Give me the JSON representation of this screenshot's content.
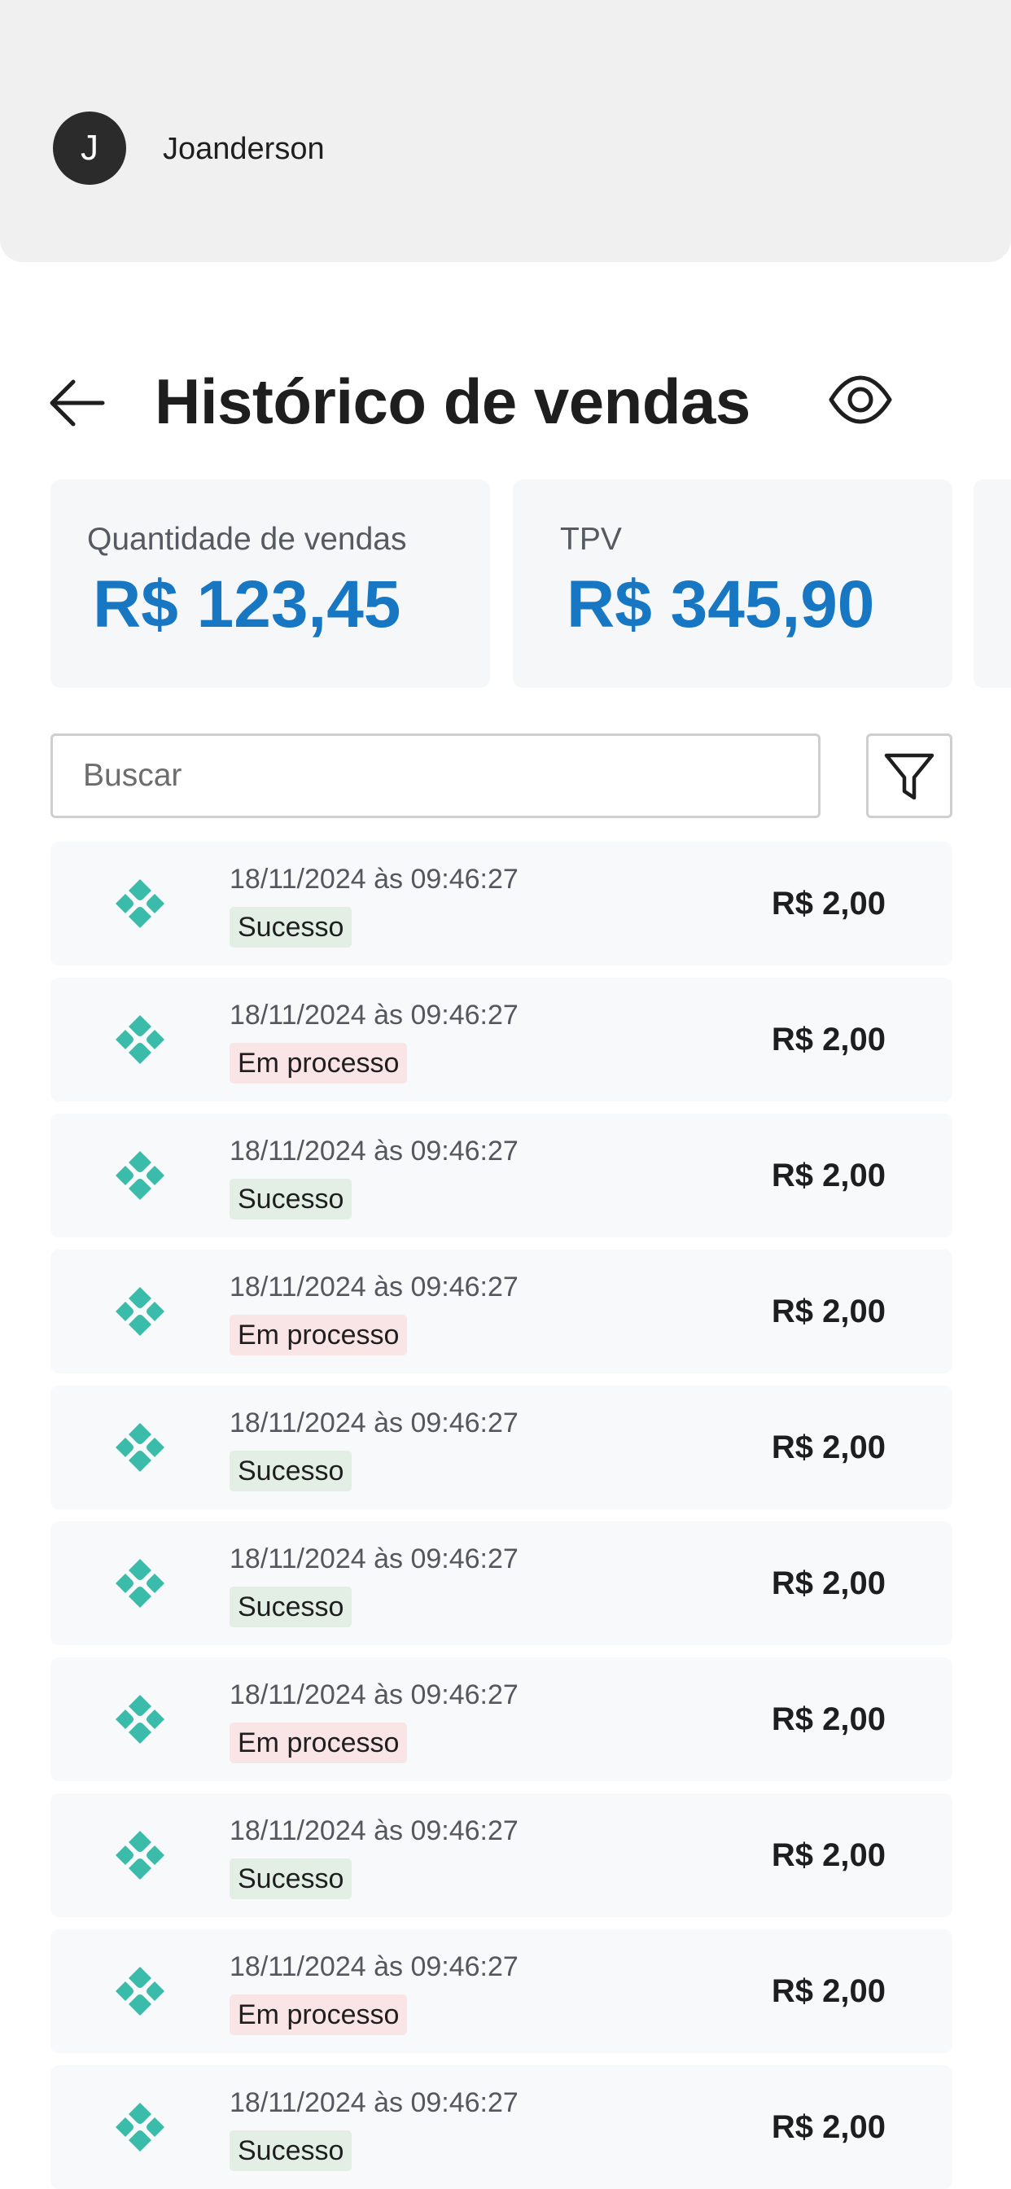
{
  "user": {
    "initial": "J",
    "name": "Joanderson"
  },
  "page": {
    "title": "Histórico de vendas"
  },
  "summary": [
    {
      "label": "Quantidade de vendas",
      "value": "R$ 123,45"
    },
    {
      "label": "TPV",
      "value": "R$ 345,90"
    }
  ],
  "search": {
    "placeholder": "Buscar"
  },
  "colors": {
    "accent": "#1877c3",
    "pix": "#3bbcaa",
    "success_bg": "#e3efe5",
    "processing_bg": "#f9e4e6"
  },
  "icons": {
    "back": "arrow-left-icon",
    "visibility": "eye-icon",
    "filter": "filter-icon",
    "payment": "pix-icon"
  },
  "transactions": [
    {
      "date": "18/11/2024 às 09:46:27",
      "status": "Sucesso",
      "status_type": "success",
      "amount": "R$ 2,00"
    },
    {
      "date": "18/11/2024 às 09:46:27",
      "status": "Em processo",
      "status_type": "processing",
      "amount": "R$ 2,00"
    },
    {
      "date": "18/11/2024 às 09:46:27",
      "status": "Sucesso",
      "status_type": "success",
      "amount": "R$ 2,00"
    },
    {
      "date": "18/11/2024 às 09:46:27",
      "status": "Em processo",
      "status_type": "processing",
      "amount": "R$ 2,00"
    },
    {
      "date": "18/11/2024 às 09:46:27",
      "status": "Sucesso",
      "status_type": "success",
      "amount": "R$ 2,00"
    },
    {
      "date": "18/11/2024 às 09:46:27",
      "status": "Sucesso",
      "status_type": "success",
      "amount": "R$ 2,00"
    },
    {
      "date": "18/11/2024 às 09:46:27",
      "status": "Em processo",
      "status_type": "processing",
      "amount": "R$ 2,00"
    },
    {
      "date": "18/11/2024 às 09:46:27",
      "status": "Sucesso",
      "status_type": "success",
      "amount": "R$ 2,00"
    },
    {
      "date": "18/11/2024 às 09:46:27",
      "status": "Em processo",
      "status_type": "processing",
      "amount": "R$ 2,00"
    },
    {
      "date": "18/11/2024 às 09:46:27",
      "status": "Sucesso",
      "status_type": "success",
      "amount": "R$ 2,00"
    }
  ]
}
